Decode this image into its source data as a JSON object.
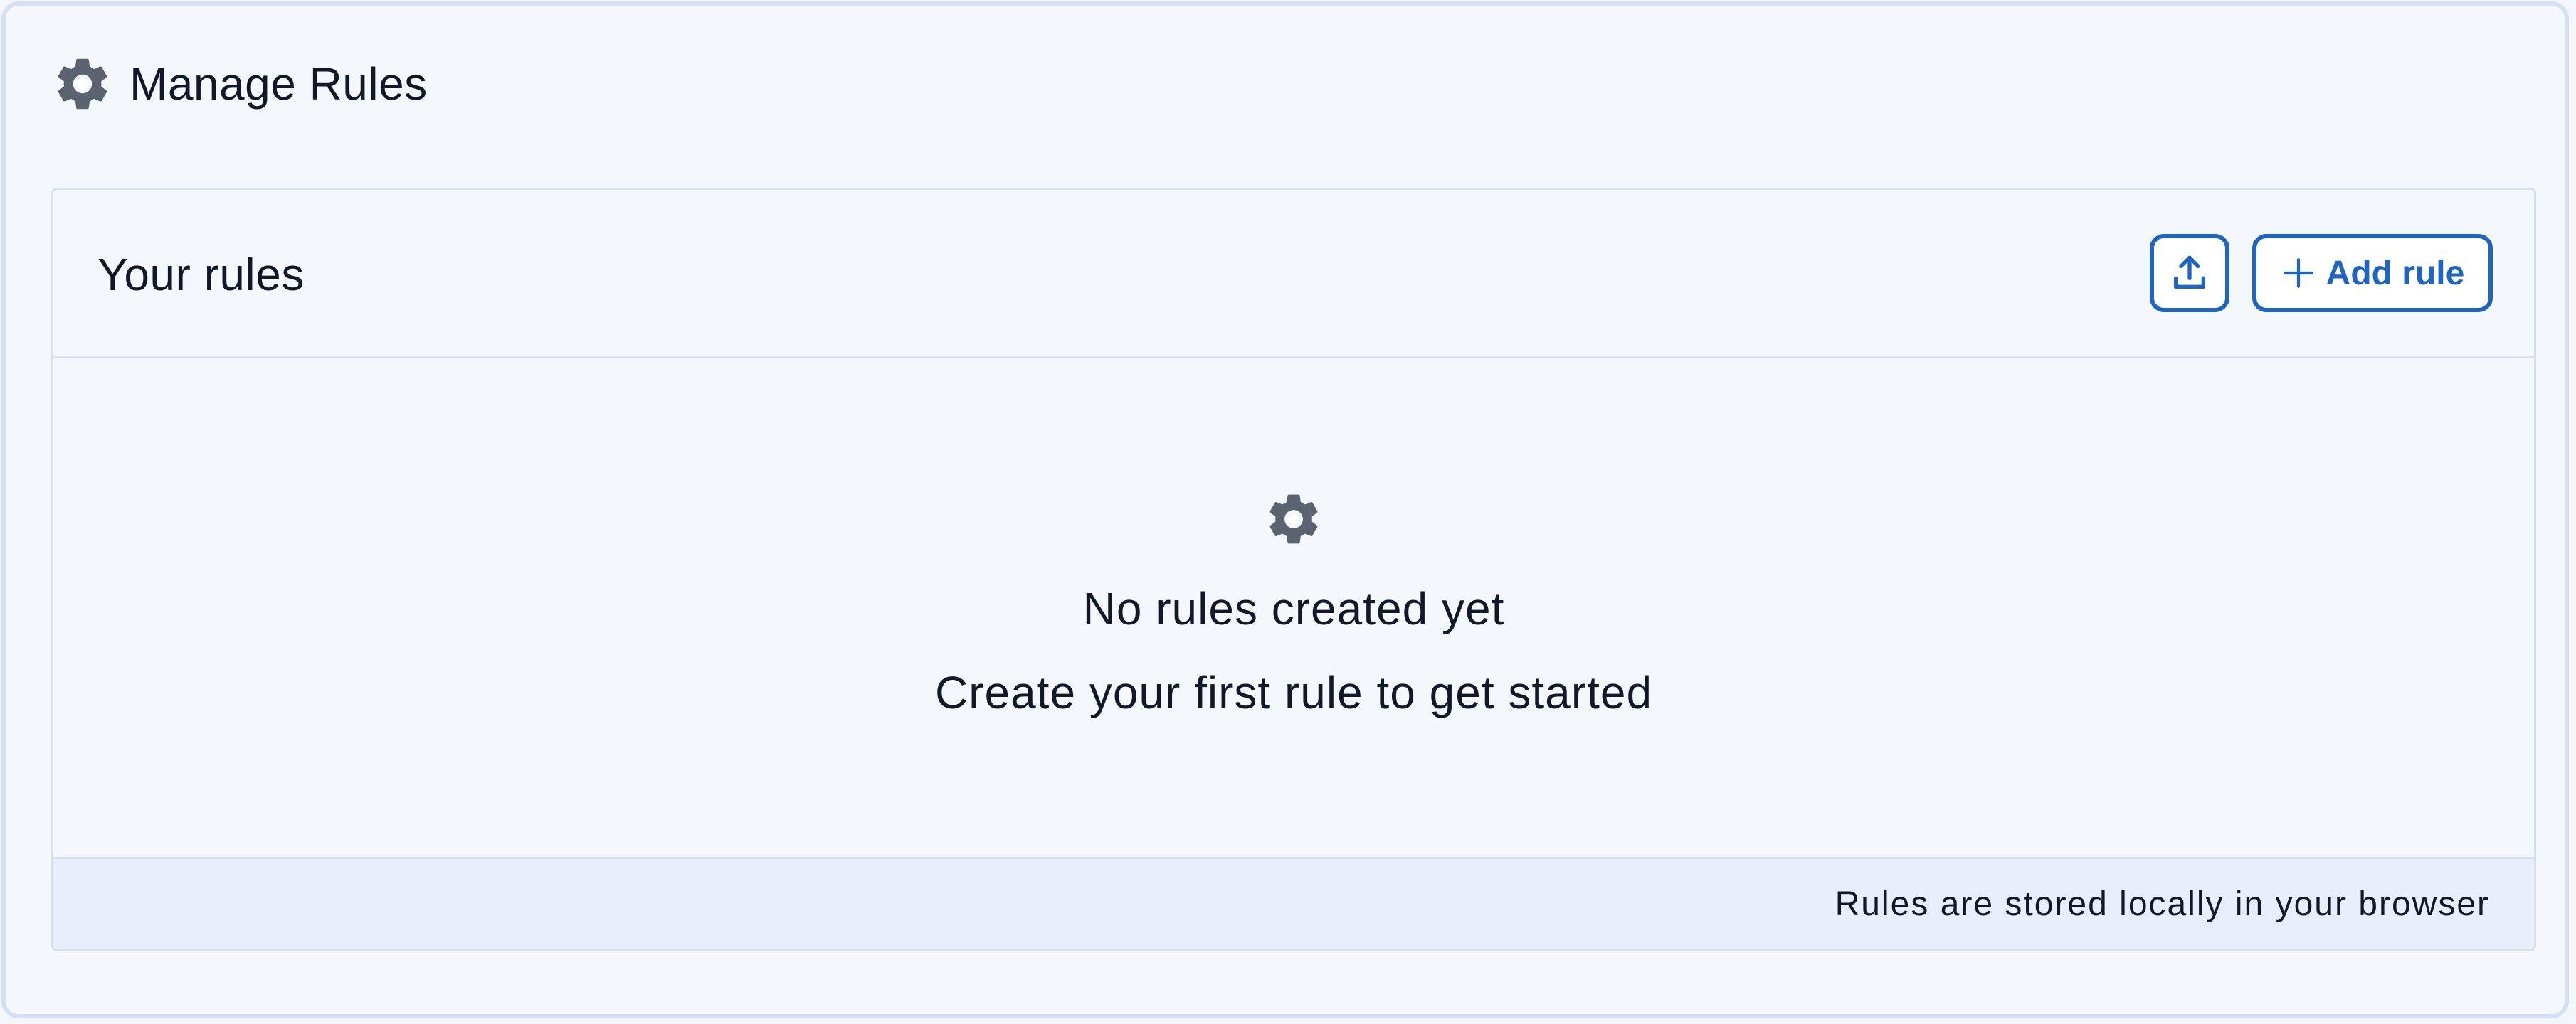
{
  "header": {
    "icon": "gear-icon",
    "title": "Manage Rules"
  },
  "rules_card": {
    "title": "Your rules",
    "upload_button_icon": "upload-icon",
    "add_button": {
      "icon": "plus-icon",
      "label": "Add rule"
    },
    "empty_state": {
      "icon": "gear-icon",
      "headline": "No rules created yet",
      "subtext": "Create your first rule to get started"
    },
    "footer_note": "Rules are stored locally in your browser"
  },
  "colors": {
    "accent": "#1e64c0",
    "icon_gray": "#5b6270",
    "background": "#f4f7fc",
    "border": "#d7e0f1",
    "footer_bg": "#e8eefa",
    "text": "#111827"
  }
}
